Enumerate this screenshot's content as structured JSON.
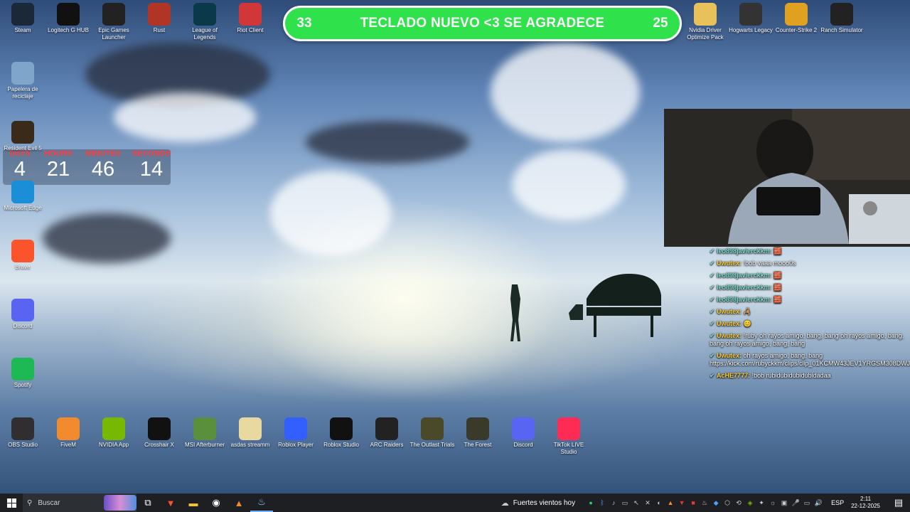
{
  "banner": {
    "left_count": "33",
    "text": "TECLADO NUEVO <3 SE AGRADECE",
    "right_count": "25"
  },
  "countdown": {
    "days_label": "DAYS",
    "days": "4",
    "hours_label": "HOURS",
    "hours": "21",
    "minutes_label": "MINUTES",
    "minutes": "46",
    "seconds_label": "SECONDS",
    "seconds": "14"
  },
  "desktop_icons": [
    {
      "label": "Steam",
      "icon": "steam-icon",
      "color": "#1b2838"
    },
    {
      "label": "Logitech G HUB",
      "icon": "logitech-icon",
      "color": "#111111"
    },
    {
      "label": "Epic Games Launcher",
      "icon": "epic-icon",
      "color": "#222222"
    },
    {
      "label": "Rust",
      "icon": "rust-icon",
      "color": "#b03524"
    },
    {
      "label": "League of Legends",
      "icon": "lol-icon",
      "color": "#0a3a4a"
    },
    {
      "label": "Riot Client",
      "icon": "riot-icon",
      "color": "#d13639"
    },
    {
      "label": "Nvidia Driver Optimize Pack",
      "icon": "folder-icon",
      "color": "#e8c15a"
    },
    {
      "label": "Hogwarts Legacy",
      "icon": "hogwarts-icon",
      "color": "#333333"
    },
    {
      "label": "Counter-Strike 2",
      "icon": "cs2-icon",
      "color": "#e0a020"
    },
    {
      "label": "Ranch Simulator",
      "icon": "ranch-icon",
      "color": "#222222"
    },
    {
      "label": "Papelera de reciclaje",
      "icon": "recycle-bin-icon",
      "color": "#7fa6c8"
    },
    {
      "label": "Resident Evil 5",
      "icon": "re5-icon",
      "color": "#3a2a1a"
    },
    {
      "label": "Microsoft Edge",
      "icon": "edge-icon",
      "color": "#1a8fd8"
    },
    {
      "label": "Brave",
      "icon": "brave-icon",
      "color": "#fb542b"
    },
    {
      "label": "Discord",
      "icon": "discord-icon",
      "color": "#5865f2"
    },
    {
      "label": "Spotify",
      "icon": "spotify-icon",
      "color": "#1db954"
    },
    {
      "label": "OBS Studio",
      "icon": "obs-icon",
      "color": "#302e31"
    },
    {
      "label": "FiveM",
      "icon": "fivem-icon",
      "color": "#f28a2e"
    },
    {
      "label": "NVIDIA App",
      "icon": "nvidia-icon",
      "color": "#76b900"
    },
    {
      "label": "Crosshair X",
      "icon": "crosshair-icon",
      "color": "#111111"
    },
    {
      "label": "MSI Afterburner",
      "icon": "afterburner-icon",
      "color": "#5a8f3c"
    },
    {
      "label": "asdas streamm",
      "icon": "folder-icon",
      "color": "#e8d9a0"
    },
    {
      "label": "Roblox Player",
      "icon": "roblox-icon",
      "color": "#335fff"
    },
    {
      "label": "Roblox Studio",
      "icon": "roblox-studio-icon",
      "color": "#111111"
    },
    {
      "label": "ARC Raiders",
      "icon": "arc-icon",
      "color": "#222222"
    },
    {
      "label": "The Outlast Trials",
      "icon": "outlast-icon",
      "color": "#4a4a2a"
    },
    {
      "label": "The Forest",
      "icon": "forest-icon",
      "color": "#3a3a2a"
    },
    {
      "label": "Discord",
      "icon": "discord-icon",
      "color": "#5865f2"
    },
    {
      "label": "TikTok LIVE Studio",
      "icon": "tiktok-icon",
      "color": "#fe2c55"
    }
  ],
  "chat": [
    {
      "user": "leo898javierckkm:",
      "user_color": "#7ee0d0",
      "msg": "🧱"
    },
    {
      "user": "Uwutex:",
      "user_color": "#ffd43a",
      "msg": "!bob vaaa mooo0s"
    },
    {
      "user": "leo898javierckkm:",
      "user_color": "#7ee0d0",
      "msg": "🧱"
    },
    {
      "user": "leo898javierckkm:",
      "user_color": "#7ee0d0",
      "msg": "🧱"
    },
    {
      "user": "leo898javierckkm:",
      "user_color": "#7ee0d0",
      "msg": "🧱"
    },
    {
      "user": "Uwutex:",
      "user_color": "#ffd43a",
      "msg": "🦂"
    },
    {
      "user": "Uwutex:",
      "user_color": "#ffd43a",
      "msg": "😊"
    },
    {
      "user": "Uwutex:",
      "user_color": "#ffd43a",
      "msg": "!ruby oh rayos amigo, bang, bang oh rayos amigo, bang, bang oh rayos amigo, bang, bang"
    },
    {
      "user": "Uwutex:",
      "user_color": "#ffd43a",
      "msg": "oh rayos amigo, bang, bang https://kick.com/rubyckkm/clips/clip_01KCMW43JEV1YRGSM308DWJPQ9"
    },
    {
      "user": "AcHE7777:",
      "user_color": "#ffd43a",
      "msg": "!bob rubidubidubidubidadaa"
    }
  ],
  "taskbar": {
    "search_placeholder": "Buscar",
    "weather": "Fuertes vientos hoy",
    "language": "ESP",
    "time": "2:11",
    "date": "22-12-2025"
  }
}
